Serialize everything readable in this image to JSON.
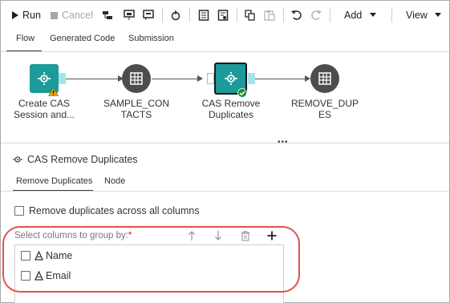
{
  "toolbar": {
    "run_label": "Run",
    "cancel_label": "Cancel",
    "add_label": "Add",
    "view_label": "View"
  },
  "tabs": [
    "Flow",
    "Generated Code",
    "Submission"
  ],
  "flow": {
    "nodes": [
      {
        "label_line1": "Create CAS",
        "label_line2": "Session and...",
        "icon": "cas-session-icon",
        "status": "warning"
      },
      {
        "label_line1": "SAMPLE_CON",
        "label_line2": "TACTS",
        "icon": "table-icon",
        "status": "none"
      },
      {
        "label_line1": "CAS Remove",
        "label_line2": "Duplicates",
        "icon": "cas-remove-duplicates-icon",
        "status": "success"
      },
      {
        "label_line1": "REMOVE_DUP",
        "label_line2": "ES",
        "icon": "table-icon",
        "status": "none"
      }
    ]
  },
  "panel": {
    "title": "CAS Remove Duplicates",
    "tabs": [
      "Remove Duplicates",
      "Node"
    ],
    "remove_all_label": "Remove duplicates across all columns",
    "group_label": "Select columns to group by:",
    "required_mark": "*",
    "columns": [
      {
        "name": "Name",
        "type_icon": "text-column-icon"
      },
      {
        "name": "Email",
        "type_icon": "text-column-icon"
      }
    ]
  },
  "colors": {
    "teal_node": "#1d9a9a",
    "dark_node": "#4d4d4d",
    "port": "#a8e3ea",
    "highlight": "#e0524e",
    "success": "#1e8a3a",
    "warning": "#e6a817"
  }
}
